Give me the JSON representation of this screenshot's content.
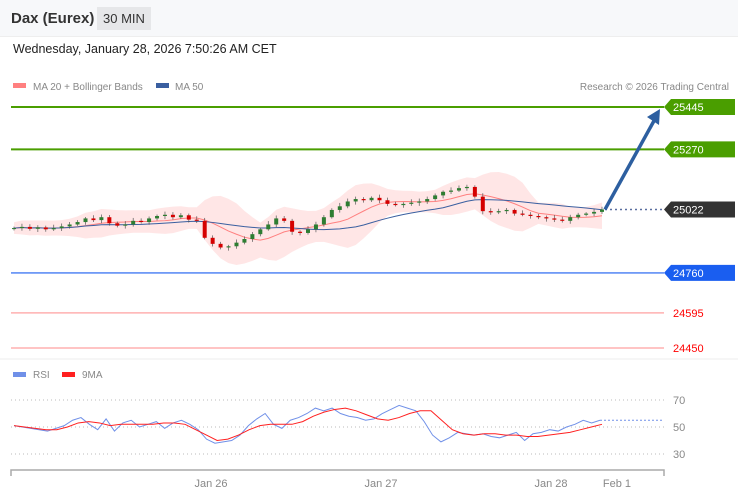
{
  "header": {
    "title": "Dax (Eurex)",
    "timeframe": "30 MIN",
    "datetime": "Wednesday, January 28, 2026 7:50:26 AM CET"
  },
  "legend": {
    "ma20": "MA 20 + Bollinger Bands",
    "ma50": "MA 50",
    "copyright": "Research © 2026 Trading Central",
    "rsi": "RSI",
    "rsi_ma": "9MA"
  },
  "colors": {
    "up": "#2e7d32",
    "down": "#d50000",
    "resistance": "#4a9e00",
    "current": "#333333",
    "pivot": "#1a5ef0",
    "support": "#ff0000",
    "ma20": "#ff8080",
    "ma50": "#3a5fa0",
    "rsi": "#7090e8",
    "rsi_ma": "#ff2020"
  },
  "chart_data": {
    "type": "candlestick",
    "price_range": [
      24450,
      25445
    ],
    "levels": [
      {
        "value": 25445,
        "label": "25445",
        "kind": "resistance"
      },
      {
        "value": 25270,
        "label": "25270",
        "kind": "resistance"
      },
      {
        "value": 25022,
        "label": "25022",
        "kind": "current"
      },
      {
        "value": 24760,
        "label": "24760",
        "kind": "pivot"
      },
      {
        "value": 24595,
        "label": "24595",
        "kind": "support"
      },
      {
        "value": 24450,
        "label": "24450",
        "kind": "support"
      }
    ],
    "target": 25445,
    "closes": [
      24945,
      24950,
      24942,
      24948,
      24940,
      24945,
      24952,
      24960,
      24970,
      24985,
      24978,
      24990,
      24965,
      24955,
      24960,
      24975,
      24970,
      24985,
      24995,
      25000,
      24990,
      24998,
      24980,
      24975,
      24905,
      24880,
      24865,
      24870,
      24885,
      24900,
      24920,
      24940,
      24960,
      24985,
      24975,
      24930,
      24925,
      24940,
      24960,
      24990,
      25020,
      25035,
      25055,
      25065,
      25060,
      25070,
      25060,
      25045,
      25040,
      25045,
      25050,
      25055,
      25065,
      25080,
      25095,
      25100,
      25110,
      25115,
      25075,
      25015,
      25010,
      25015,
      25020,
      25005,
      25000,
      24995,
      24990,
      24985,
      24980,
      24975,
      24990,
      25000,
      25005,
      25012,
      25022
    ],
    "rsi": {
      "axis": [
        30,
        50,
        70
      ],
      "values": [
        51,
        50,
        49,
        48,
        47,
        49,
        51,
        55,
        57,
        52,
        48,
        56,
        47,
        53,
        55,
        50,
        52,
        54,
        49,
        53,
        55,
        52,
        48,
        41,
        38,
        39,
        40,
        44,
        51,
        56,
        60,
        52,
        49,
        55,
        57,
        60,
        64,
        62,
        64,
        60,
        58,
        57,
        55,
        56,
        60,
        63,
        66,
        64,
        62,
        54,
        44,
        39,
        42,
        46,
        45,
        44,
        45,
        43,
        42,
        44,
        46,
        40,
        45,
        46,
        48,
        47,
        50,
        52,
        55,
        53,
        55
      ]
    },
    "rsi_ma": [
      51,
      50,
      49,
      48,
      48,
      50,
      53,
      54,
      53,
      51,
      52,
      52,
      52,
      52,
      53,
      53,
      52,
      48,
      44,
      40,
      41,
      44,
      48,
      51,
      52,
      52,
      52,
      54,
      58,
      61,
      63,
      64,
      62,
      59,
      56,
      55,
      57,
      60,
      62,
      62,
      55,
      48,
      45,
      44,
      45,
      45,
      44,
      44,
      43,
      43,
      44,
      45,
      46,
      48,
      50,
      52
    ],
    "x_labels": [
      "Jan 26",
      "Jan 27",
      "Jan 28",
      "Feb 1"
    ]
  }
}
